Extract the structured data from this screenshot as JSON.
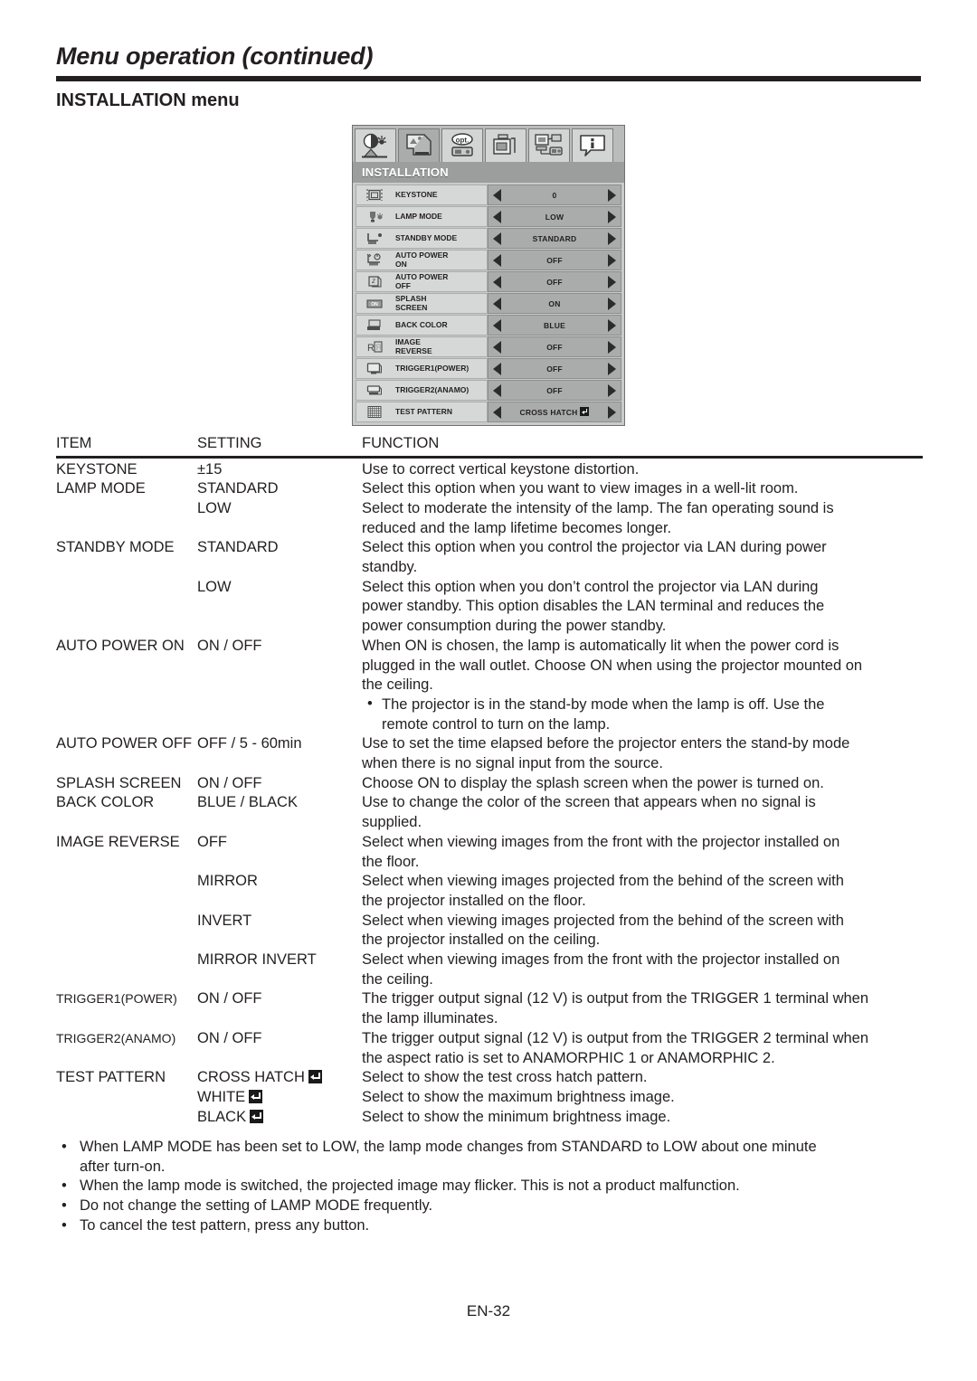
{
  "header": {
    "title": "Menu operation (continued)",
    "section_title": "INSTALLATION menu"
  },
  "osd": {
    "menu_title": "INSTALLATION",
    "tabs": [
      {
        "name": "image-menu-tab",
        "selected": false
      },
      {
        "name": "installation-menu-tab",
        "selected": true
      },
      {
        "name": "option-menu-tab",
        "selected": false
      },
      {
        "name": "signal-menu-tab",
        "selected": false
      },
      {
        "name": "network-menu-tab",
        "selected": false
      },
      {
        "name": "information-menu-tab",
        "selected": false
      }
    ],
    "rows": [
      {
        "label1": "KEYSTONE",
        "label2": "",
        "value": "0",
        "enter": false,
        "icon": "keystone-icon"
      },
      {
        "label1": "LAMP MODE",
        "label2": "",
        "value": "LOW",
        "enter": false,
        "icon": "lamp-icon"
      },
      {
        "label1": "STANDBY MODE",
        "label2": "",
        "value": "STANDARD",
        "enter": false,
        "icon": "standby-icon"
      },
      {
        "label1": "AUTO POWER",
        "label2": "ON",
        "value": "OFF",
        "enter": false,
        "icon": "auto-power-on-icon"
      },
      {
        "label1": "AUTO POWER",
        "label2": "OFF",
        "value": "OFF",
        "enter": false,
        "icon": "auto-power-off-icon"
      },
      {
        "label1": "SPLASH",
        "label2": "SCREEN",
        "value": "ON",
        "enter": false,
        "icon": "splash-screen-icon"
      },
      {
        "label1": "BACK COLOR",
        "label2": "",
        "value": "BLUE",
        "enter": false,
        "icon": "back-color-icon"
      },
      {
        "label1": "IMAGE",
        "label2": "REVERSE",
        "value": "OFF",
        "enter": false,
        "icon": "image-reverse-icon"
      },
      {
        "label1": "TRIGGER1(POWER)",
        "label2": "",
        "value": "OFF",
        "enter": false,
        "icon": "trigger1-icon"
      },
      {
        "label1": "TRIGGER2(ANAMO)",
        "label2": "",
        "value": "OFF",
        "enter": false,
        "icon": "trigger2-icon"
      },
      {
        "label1": "TEST PATTERN",
        "label2": "",
        "value": "CROSS HATCH",
        "enter": true,
        "icon": "test-pattern-icon"
      }
    ]
  },
  "table": {
    "headers": {
      "item": "ITEM",
      "setting": "SETTING",
      "function": "FUNCTION"
    },
    "rows": [
      {
        "item": "KEYSTONE",
        "setting": "±15",
        "lines": [
          "Use to correct vertical keystone distortion."
        ]
      },
      {
        "item": "LAMP MODE",
        "setting": "STANDARD",
        "lines": [
          "Select this option when you want to view images in a well-lit room."
        ]
      },
      {
        "item": "",
        "setting": "LOW",
        "lines": [
          "Select to moderate the intensity of the lamp. The fan operating sound is",
          "reduced and the lamp lifetime becomes longer."
        ]
      },
      {
        "item": "STANDBY MODE",
        "setting": "STANDARD",
        "lines": [
          "Select this option when you control the projector via LAN during power",
          "standby."
        ]
      },
      {
        "item": "",
        "setting": "LOW",
        "lines": [
          "Select this option when you don’t control the projector via LAN during",
          "power standby. This option disables the LAN terminal and reduces the",
          "power consumption during the power standby."
        ]
      },
      {
        "item": "AUTO POWER ON",
        "setting": "ON / OFF",
        "lines": [
          "When ON is chosen, the lamp is automatically lit when the power cord is",
          "plugged in the wall outlet. Choose ON when using the projector mounted on",
          "the ceiling."
        ],
        "bullets": [
          [
            "The projector is in the stand-by mode when the lamp is off. Use the",
            "remote control to turn on the lamp."
          ]
        ]
      },
      {
        "item": "AUTO POWER OFF",
        "setting": "OFF / 5 - 60min",
        "lines": [
          "Use to set the time elapsed before the projector enters the stand-by mode",
          "when there is no signal input from the source."
        ]
      },
      {
        "item": "SPLASH SCREEN",
        "setting": "ON / OFF",
        "lines": [
          "Choose ON to display the splash screen when the power is turned on."
        ]
      },
      {
        "item": "BACK COLOR",
        "setting": "BLUE / BLACK",
        "lines": [
          "Use to change the color of the screen that appears when no signal is",
          "supplied."
        ]
      },
      {
        "item": "IMAGE REVERSE",
        "setting": "OFF",
        "lines": [
          "Select when viewing images from the front with the projector installed on",
          "the floor."
        ]
      },
      {
        "item": "",
        "setting": "MIRROR",
        "lines": [
          "Select when viewing images projected from the behind of the screen with",
          "the projector installed on the floor."
        ]
      },
      {
        "item": "",
        "setting": "INVERT",
        "lines": [
          "Select when viewing images projected from the behind of the screen with",
          "the projector installed on the ceiling."
        ]
      },
      {
        "item": "",
        "setting": "MIRROR INVERT",
        "lines": [
          "Select when viewing images from the front with the projector installed on",
          "the ceiling."
        ]
      },
      {
        "item": "TRIGGER1(POWER)",
        "item_small": true,
        "setting": "ON / OFF",
        "lines": [
          "The trigger output signal (12 V) is output from the TRIGGER 1 terminal when",
          "the lamp illuminates."
        ]
      },
      {
        "item": "TRIGGER2(ANAMO)",
        "item_small": true,
        "setting": "ON / OFF",
        "lines": [
          "The trigger output signal (12 V) is output from the TRIGGER 2 terminal when",
          "the aspect ratio is set to ANAMORPHIC 1 or ANAMORPHIC 2."
        ]
      },
      {
        "item": "TEST PATTERN",
        "setting": "CROSS HATCH",
        "setting_enter": true,
        "lines": [
          "Select to show the test cross hatch pattern."
        ]
      },
      {
        "item": "",
        "setting": "WHITE",
        "setting_enter": true,
        "lines": [
          "Select to show the maximum brightness image."
        ]
      },
      {
        "item": "",
        "setting": "BLACK",
        "setting_enter": true,
        "lines": [
          "Select to show the minimum brightness image."
        ]
      }
    ]
  },
  "notes": [
    [
      "When LAMP MODE has been set to LOW, the lamp mode changes from STANDARD to LOW about one minute",
      "after turn-on."
    ],
    [
      "When the lamp mode is switched, the projected image may flicker. This is not a product malfunction."
    ],
    [
      "Do not change the setting of LAMP MODE frequently."
    ],
    [
      "To cancel the test pattern, press any button."
    ]
  ],
  "footer": {
    "page_number": "EN-32"
  }
}
